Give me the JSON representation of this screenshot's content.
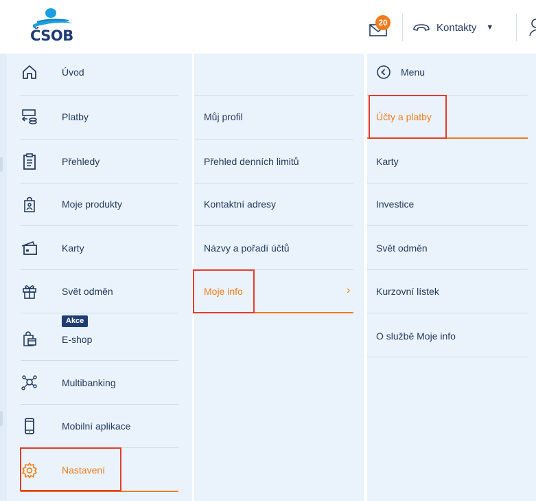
{
  "header": {
    "logo_text": "ČSOB",
    "notification_count": "20",
    "contacts_label": "Kontakty"
  },
  "main_menu": {
    "items": [
      {
        "label": "Úvod",
        "icon": "home-icon"
      },
      {
        "label": "Platby",
        "icon": "payments-icon"
      },
      {
        "label": "Přehledy",
        "icon": "clipboard-icon"
      },
      {
        "label": "Moje produkty",
        "icon": "products-icon"
      },
      {
        "label": "Karty",
        "icon": "card-icon"
      },
      {
        "label": "Svět odměn",
        "icon": "gift-icon"
      },
      {
        "label": "E-shop",
        "icon": "shopping-bag-icon",
        "badge": "Akce"
      },
      {
        "label": "Multibanking",
        "icon": "multibanking-icon"
      },
      {
        "label": "Mobilní aplikace",
        "icon": "mobile-icon"
      },
      {
        "label": "Nastavení",
        "icon": "gear-icon",
        "active": true
      }
    ]
  },
  "settings_menu": {
    "items": [
      {
        "label": "Můj profil"
      },
      {
        "label": "Přehled denních limitů"
      },
      {
        "label": "Kontaktní adresy"
      },
      {
        "label": "Názvy a pořadí účtů"
      },
      {
        "label": "Moje info",
        "active": true
      }
    ]
  },
  "moje_info_menu": {
    "back_label": "Menu",
    "items": [
      {
        "label": "Účty a platby",
        "active": true
      },
      {
        "label": "Karty"
      },
      {
        "label": "Investice"
      },
      {
        "label": "Svět odměn"
      },
      {
        "label": "Kurzovní lístek"
      },
      {
        "label": "O službě Moje info"
      }
    ]
  },
  "colors": {
    "accent": "#f07c1c",
    "navy": "#1f3c74",
    "panel": "#eaf3fb",
    "highlight": "#e23c2c"
  }
}
